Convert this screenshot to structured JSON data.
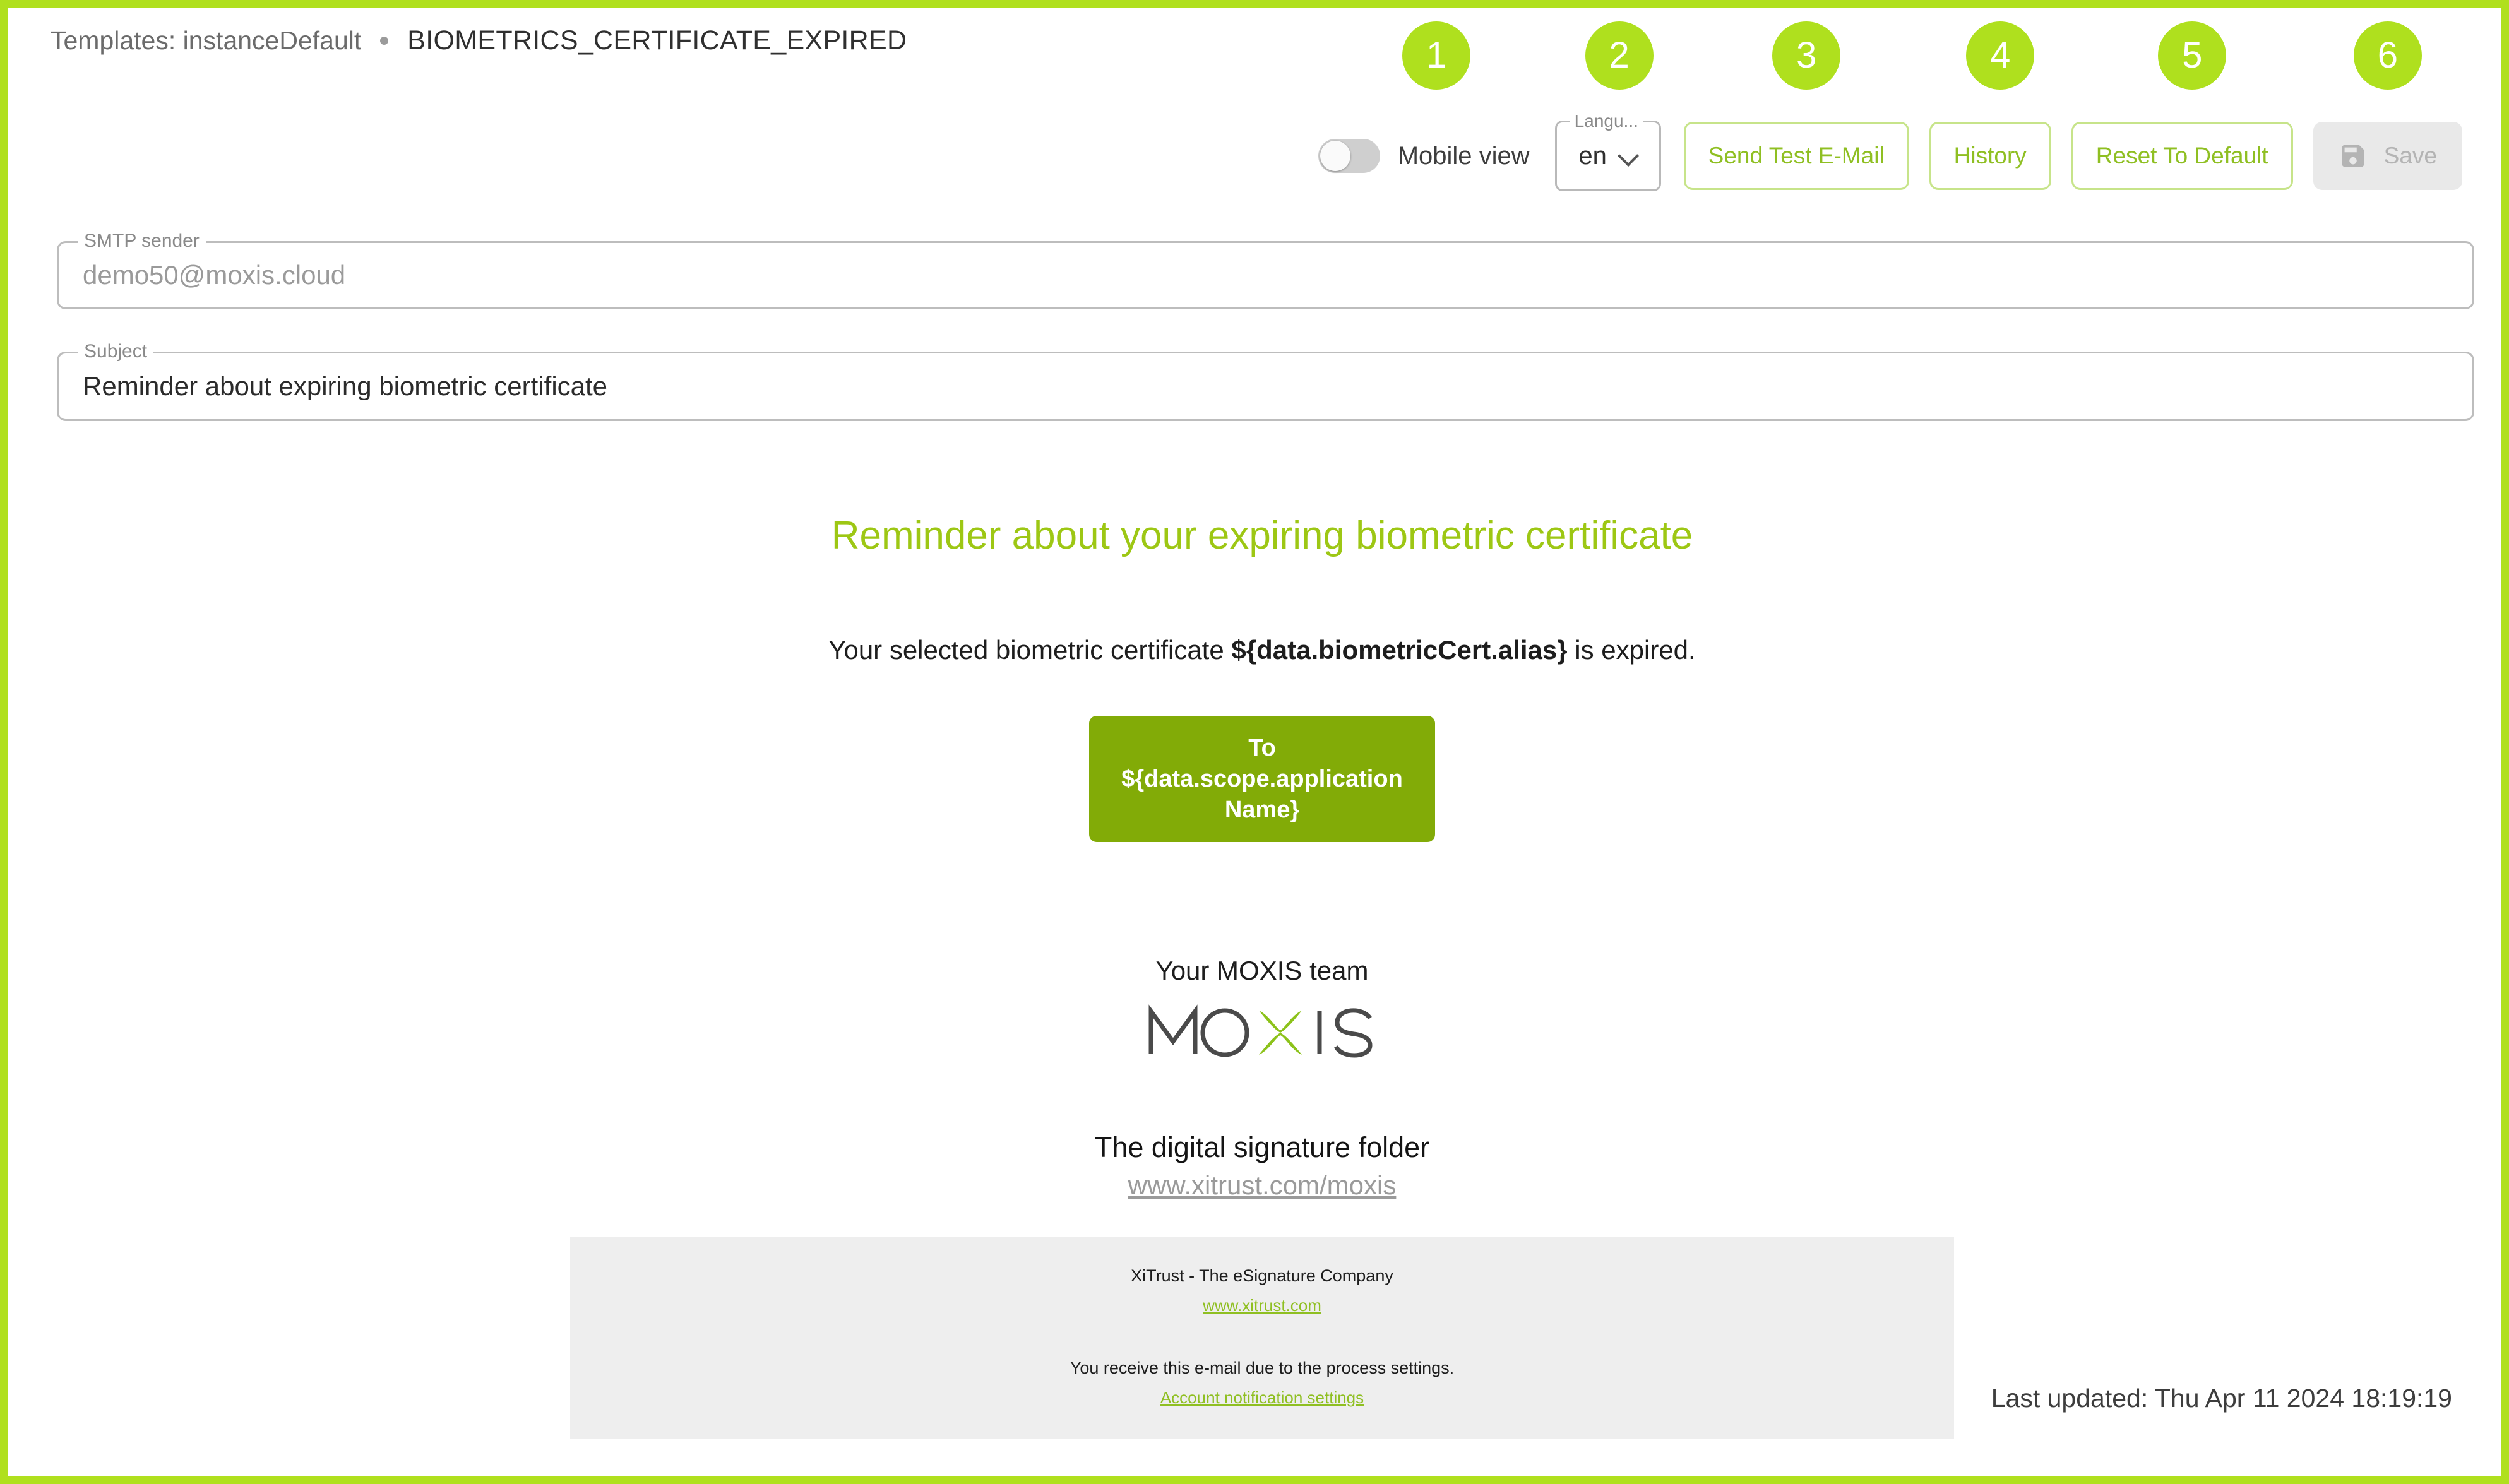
{
  "breadcrumb": {
    "templates_label": "Templates: instanceDefault",
    "current": "BIOMETRICS_CERTIFICATE_EXPIRED"
  },
  "toolbar": {
    "badges": [
      "1",
      "2",
      "3",
      "4",
      "5",
      "6"
    ],
    "mobile_view_label": "Mobile view",
    "mobile_view_state": "off",
    "language_legend": "Langu...",
    "language_value": "en",
    "send_test_email_label": "Send Test E-Mail",
    "history_label": "History",
    "reset_to_default_label": "Reset To Default",
    "save_label": "Save",
    "save_disabled": true
  },
  "fields": {
    "smtp_sender": {
      "legend": "SMTP sender",
      "value": "demo50@moxis.cloud"
    },
    "subject": {
      "legend": "Subject",
      "value": "Reminder about expiring biometric certificate"
    }
  },
  "email_preview": {
    "heading": "Reminder about your expiring biometric certificate",
    "intro_prefix": "Your selected biometric certificate ",
    "intro_variable": "${data.biometricCert.alias}",
    "intro_suffix": " is expired.",
    "cta_line1": "To",
    "cta_line2": "${data.scope.application",
    "cta_line3": "Name}",
    "signoff": "Your MOXIS team",
    "logo_text": "MOXIS",
    "tagline": "The digital signature folder",
    "tagline_link": "www.xitrust.com/moxis",
    "footer": {
      "company": "XiTrust - The eSignature Company",
      "company_link": "www.xitrust.com",
      "notice": "You receive this e-mail due to the process settings.",
      "notice_link": "Account notification settings"
    }
  },
  "status": {
    "last_updated": "Last updated: Thu Apr 11 2024 18:19:19"
  },
  "colors": {
    "frame_green": "#b0e01e",
    "badge_green": "#afe01e",
    "heading_green": "#9dc714",
    "cta_green": "#82ab07",
    "link_green": "#8fbf22",
    "button_outline": "#c7e48a",
    "footer_bg": "#eeeeee"
  }
}
